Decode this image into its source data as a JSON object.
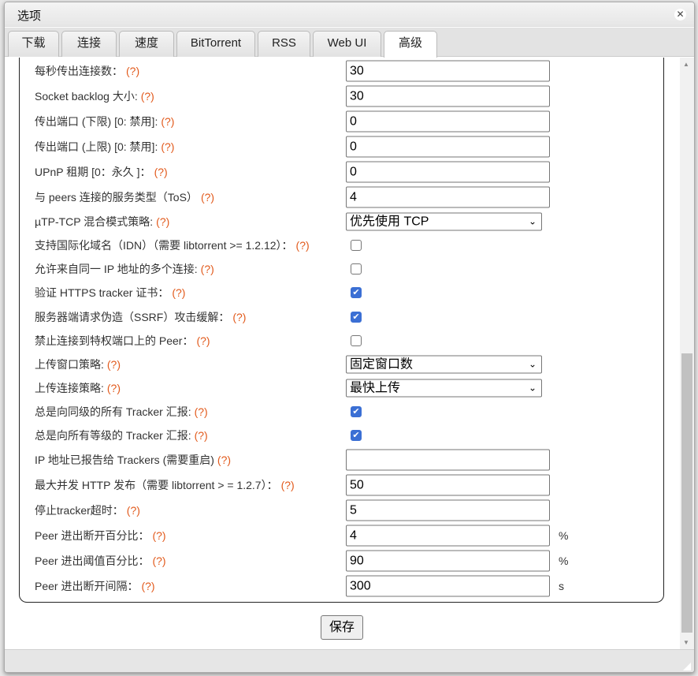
{
  "dialog": {
    "title": "选项"
  },
  "tabs": [
    {
      "label": "下载"
    },
    {
      "label": "连接"
    },
    {
      "label": "速度"
    },
    {
      "label": "BitTorrent"
    },
    {
      "label": "RSS"
    },
    {
      "label": "Web UI"
    },
    {
      "label": "高级",
      "active": true
    }
  ],
  "help_text": "(?)",
  "rows": [
    {
      "label": "每秒传出连接数：",
      "type": "input",
      "value": "30"
    },
    {
      "label": "Socket backlog 大小:",
      "type": "input",
      "value": "30"
    },
    {
      "label": "传出端口 (下限) [0: 禁用]:",
      "type": "input",
      "value": "0"
    },
    {
      "label": "传出端口 (上限) [0: 禁用]:",
      "type": "input",
      "value": "0"
    },
    {
      "label": "UPnP 租期 [0：永久 ]：",
      "type": "input",
      "value": "0"
    },
    {
      "label": "与 peers 连接的服务类型（ToS）",
      "type": "input",
      "value": "4"
    },
    {
      "label": "µTP-TCP 混合模式策略:",
      "type": "select",
      "value": "优先使用 TCP"
    },
    {
      "label": "支持国际化域名（IDN）（需要 libtorrent >= 1.2.12）：",
      "type": "check",
      "checked": false
    },
    {
      "label": "允许来自同一 IP 地址的多个连接:",
      "type": "check",
      "checked": false
    },
    {
      "label": "验证 HTTPS tracker 证书：",
      "type": "check",
      "checked": true
    },
    {
      "label": "服务器端请求伪造（SSRF）攻击缓解：",
      "type": "check",
      "checked": true
    },
    {
      "label": "禁止连接到特权端口上的 Peer：",
      "type": "check",
      "checked": false
    },
    {
      "label": "上传窗口策略:",
      "type": "select",
      "value": "固定窗口数"
    },
    {
      "label": "上传连接策略:",
      "type": "select",
      "value": "最快上传"
    },
    {
      "label": "总是向同级的所有 Tracker 汇报:",
      "type": "check",
      "checked": true
    },
    {
      "label": "总是向所有等级的 Tracker 汇报:",
      "type": "check",
      "checked": true
    },
    {
      "label": "IP 地址已报告给 Trackers (需要重启)",
      "type": "input",
      "value": ""
    },
    {
      "label": "最大并发 HTTP 发布（需要 libtorrent > = 1.2.7）：",
      "type": "input",
      "value": "50"
    },
    {
      "label": "停止tracker超时：",
      "type": "input",
      "value": "5"
    },
    {
      "label": "Peer 进出断开百分比：",
      "type": "input",
      "value": "4",
      "unit": "%"
    },
    {
      "label": "Peer 进出阈值百分比：",
      "type": "input",
      "value": "90",
      "unit": "%"
    },
    {
      "label": "Peer 进出断开间隔：",
      "type": "input",
      "value": "300",
      "unit": "s"
    }
  ],
  "save_label": "保存"
}
